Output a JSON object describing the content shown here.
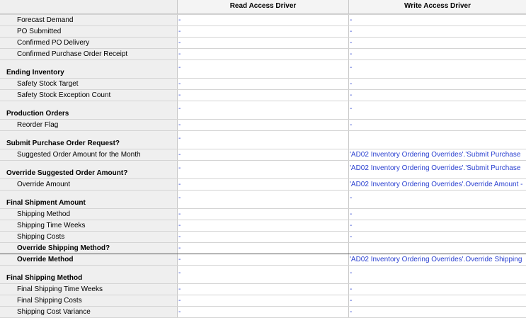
{
  "columns": [
    "",
    "Read Access Driver",
    "Write Access Driver"
  ],
  "rows": [
    {
      "label": "Forecast Demand",
      "type": "sub",
      "read": "-",
      "write": "-"
    },
    {
      "label": "PO Submitted",
      "type": "sub",
      "read": "-",
      "write": "-"
    },
    {
      "label": "Confirmed PO Delivery",
      "type": "sub",
      "read": "-",
      "write": "-"
    },
    {
      "label": "Confirmed Purchase Order Receipt",
      "type": "sub",
      "read": "-",
      "write": "-"
    },
    {
      "label": "Ending Inventory",
      "type": "sec",
      "read": "-",
      "write": "-"
    },
    {
      "label": "Safety Stock Target",
      "type": "sub",
      "read": "-",
      "write": "-"
    },
    {
      "label": "Safety Stock Exception Count",
      "type": "sub",
      "read": "-",
      "write": "-"
    },
    {
      "label": "Production Orders",
      "type": "sec",
      "read": "-",
      "write": "-"
    },
    {
      "label": "Reorder Flag",
      "type": "sub",
      "read": "-",
      "write": "-"
    },
    {
      "label": "Submit Purchase Order Request?",
      "type": "sec",
      "read": "-",
      "write": ""
    },
    {
      "label": "Suggested Order Amount for the Month",
      "type": "sub",
      "read": "-",
      "write": "'AD02 Inventory Ordering Overrides'.'Submit Purchase"
    },
    {
      "label": "Override Suggested Order Amount?",
      "type": "sec",
      "read": "-",
      "write": "'AD02 Inventory Ordering Overrides'.'Submit Purchase"
    },
    {
      "label": "Override Amount",
      "type": "sub",
      "read": "-",
      "write": "'AD02 Inventory Ordering Overrides'.Override Amount -"
    },
    {
      "label": "Final Shipment Amount",
      "type": "sec",
      "read": "-",
      "write": "-"
    },
    {
      "label": "Shipping Method",
      "type": "sub",
      "read": "-",
      "write": "-"
    },
    {
      "label": "Shipping Time Weeks",
      "type": "sub",
      "read": "-",
      "write": "-"
    },
    {
      "label": "Shipping Costs",
      "type": "sub",
      "read": "-",
      "write": "-"
    },
    {
      "label": "Override Shipping Method?",
      "type": "subbold",
      "read": "-",
      "write": ""
    },
    {
      "label": "Override Method",
      "type": "subbold",
      "read": "-",
      "write": "'AD02 Inventory Ordering Overrides'.Override Shipping"
    },
    {
      "label": "Final Shipping Method",
      "type": "sec",
      "read": "-",
      "write": "-"
    },
    {
      "label": "Final Shipping Time Weeks",
      "type": "sub",
      "read": "-",
      "write": "-"
    },
    {
      "label": "Final Shipping Costs",
      "type": "sub",
      "read": "-",
      "write": "-"
    },
    {
      "label": "Shipping Cost Variance",
      "type": "sub",
      "read": "-",
      "write": "-"
    }
  ]
}
